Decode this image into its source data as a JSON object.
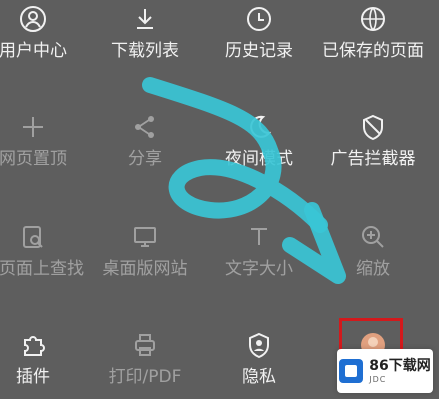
{
  "menu": {
    "row1": [
      {
        "label": "用户中心",
        "icon": "user-icon"
      },
      {
        "label": "下载列表",
        "icon": "download-icon"
      },
      {
        "label": "历史记录",
        "icon": "clock-icon"
      },
      {
        "label": "已保存的页面",
        "icon": "globe-icon"
      }
    ],
    "row2": [
      {
        "label": "网页置顶",
        "icon": "plus-icon"
      },
      {
        "label": "分享",
        "icon": "share-icon"
      },
      {
        "label": "夜间模式",
        "icon": "moon-icon"
      },
      {
        "label": "广告拦截器",
        "icon": "shield-icon"
      }
    ],
    "row3": [
      {
        "label": "在页面上查找",
        "icon": "search-page-icon"
      },
      {
        "label": "桌面版网站",
        "icon": "desktop-icon"
      },
      {
        "label": "文字大小",
        "icon": "text-size-icon"
      },
      {
        "label": "缩放",
        "icon": "zoom-icon"
      }
    ],
    "row4": [
      {
        "label": "插件",
        "icon": "puzzle-icon"
      },
      {
        "label": "打印/PDF",
        "icon": "print-icon"
      },
      {
        "label": "隐私",
        "icon": "privacy-icon"
      },
      {
        "label": "",
        "icon": "avatar-icon"
      }
    ]
  },
  "watermark": {
    "title": "86下载网",
    "sub": "JDC"
  },
  "colors": {
    "background": "#5e5e5e",
    "arrow": "#39c6d6",
    "highlight": "#d3191c"
  }
}
